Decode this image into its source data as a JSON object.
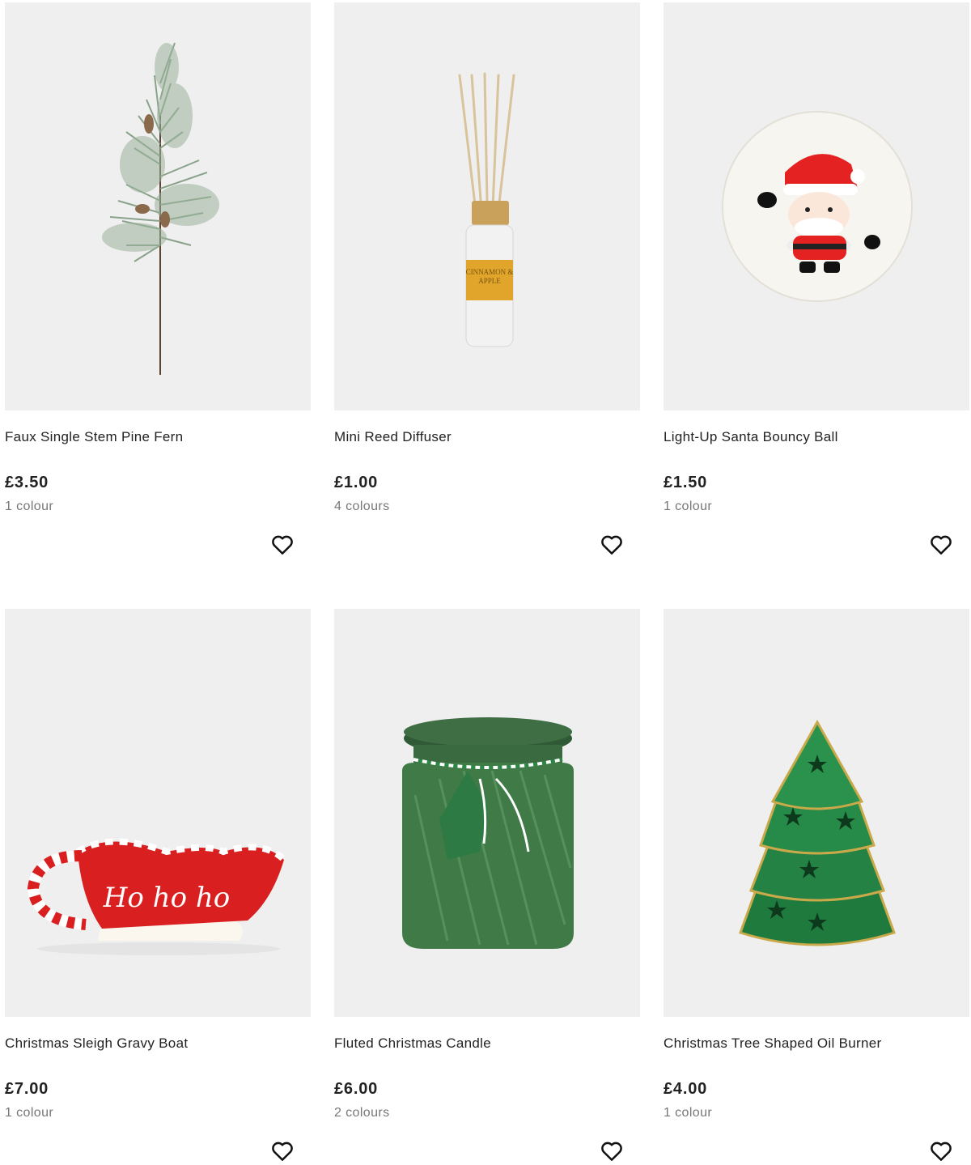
{
  "products": [
    {
      "title": "Faux Single Stem Pine Fern",
      "price": "£3.50",
      "colours": "1 colour",
      "image": "pine-fern-image"
    },
    {
      "title": "Mini Reed Diffuser",
      "price": "£1.00",
      "colours": "4 colours",
      "image": "reed-diffuser-image",
      "label_text": "CINNAMON & APPLE"
    },
    {
      "title": "Light-Up Santa Bouncy Ball",
      "price": "£1.50",
      "colours": "1 colour",
      "image": "santa-ball-image"
    },
    {
      "title": "Christmas Sleigh Gravy Boat",
      "price": "£7.00",
      "colours": "1 colour",
      "image": "sleigh-gravy-boat-image",
      "label_text": "Ho ho ho"
    },
    {
      "title": "Fluted Christmas Candle",
      "price": "£6.00",
      "colours": "2 colours",
      "image": "fluted-candle-image"
    },
    {
      "title": "Christmas Tree Shaped Oil Burner",
      "price": "£4.00",
      "colours": "1 colour",
      "image": "tree-oil-burner-image"
    }
  ],
  "icons": {
    "wishlist": "heart-outline-icon"
  },
  "colors": {
    "image_bg": "#efefef",
    "price_text": "#222222",
    "colours_text": "#777777"
  }
}
